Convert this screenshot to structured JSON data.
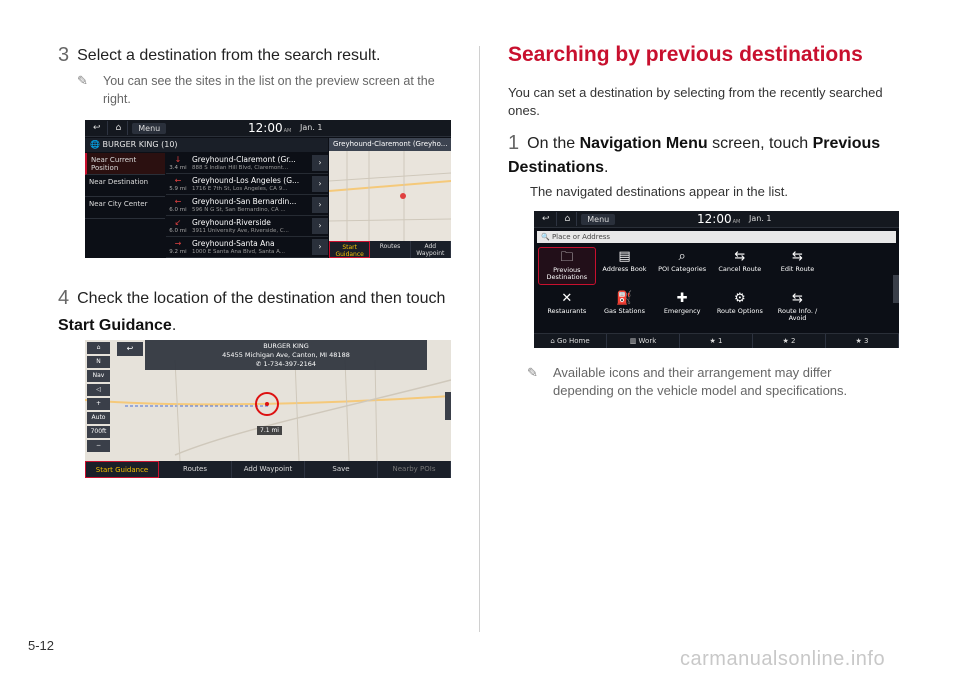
{
  "left": {
    "step3": {
      "num": "3",
      "text": "Select a destination from the search result."
    },
    "note3": "You can see the sites in the list on the preview screen at the right.",
    "step4": {
      "num": "4",
      "text_a": "Check the location of the destination and then touch ",
      "bold": "Start Guidance",
      "text_b": "."
    }
  },
  "screen_search": {
    "menu": "Menu",
    "time": "12:00",
    "ampm": "AM",
    "date": "Jan. 1",
    "query": "BURGER KING (10)",
    "options": [
      "Near Current Position",
      "Near Destination",
      "Near City Center"
    ],
    "results": [
      {
        "dist": "3.4 mi",
        "dir": "↓",
        "name": "Greyhound-Claremont (Gr...",
        "addr": "888 S Indian Hill Blvd, Claremont..."
      },
      {
        "dist": "5.9 mi",
        "dir": "←",
        "name": "Greyhound-Los Angeles (G...",
        "addr": "1716 E 7th St, Los Angeles, CA 9..."
      },
      {
        "dist": "6.0 mi",
        "dir": "←",
        "name": "Greyhound-San Bernardin...",
        "addr": "596 N G St, San Bernardino, CA ..."
      },
      {
        "dist": "6.0 mi",
        "dir": "↙",
        "name": "Greyhound-Riverside",
        "addr": "3911 University Ave, Riverside, C..."
      },
      {
        "dist": "9.2 mi",
        "dir": "→",
        "name": "Greyhound-Santa Ana",
        "addr": "1000 E Santa Ana Blvd, Santa A..."
      }
    ],
    "map_title": "Greyhound-Claremont (Greyho...",
    "buttons": [
      "Start Guidance",
      "Routes",
      "Add Waypoint"
    ]
  },
  "screen_guidance": {
    "place_name": "BURGER KING",
    "address": "45455 Michigan Ave, Canton, MI 48188",
    "phone": "1-734-397-2164",
    "scale": "700ft",
    "auto": "Auto",
    "nav_label": "Nav",
    "distance": "7.1 mi",
    "buttons": [
      "Start Guidance",
      "Routes",
      "Add Waypoint",
      "Save",
      "Nearby POIs"
    ]
  },
  "right": {
    "title": "Searching by previous destinations",
    "intro": "You can set a destination by selecting from the recently searched ones.",
    "step1": {
      "num": "1",
      "a": "On the ",
      "b1": "Navigation Menu",
      "c": " screen, touch ",
      "b2": "Previous Destinations",
      "d": "."
    },
    "step1_sub": "The navigated destinations appear in the list.",
    "note": "Available icons and their arrangement may differ depending on the vehicle model and specifications."
  },
  "screen_nav": {
    "menu": "Menu",
    "time": "12:00",
    "ampm": "AM",
    "date": "Jan. 1",
    "search_placeholder": "Place or Address",
    "items": [
      {
        "label": "Previous Destinations",
        "icon": "folder-icon"
      },
      {
        "label": "Address Book",
        "icon": "book-icon"
      },
      {
        "label": "POI Categories",
        "icon": "poi-icon"
      },
      {
        "label": "Cancel Route",
        "icon": "cancel-route-icon"
      },
      {
        "label": "Edit Route",
        "icon": "edit-route-icon"
      },
      {
        "label": "",
        "icon": ""
      },
      {
        "label": "Restaurants",
        "icon": "fork-knife-icon"
      },
      {
        "label": "Gas Stations",
        "icon": "gas-icon"
      },
      {
        "label": "Emergency",
        "icon": "emergency-icon"
      },
      {
        "label": "Route Options",
        "icon": "gear-icon"
      },
      {
        "label": "Route Info. / Avoid",
        "icon": "route-info-icon"
      },
      {
        "label": "",
        "icon": ""
      }
    ],
    "bottom": [
      "Go Home",
      "Work",
      "1",
      "2",
      "3"
    ]
  },
  "page_number": "5-12",
  "watermark": "carmanualsonline.info"
}
